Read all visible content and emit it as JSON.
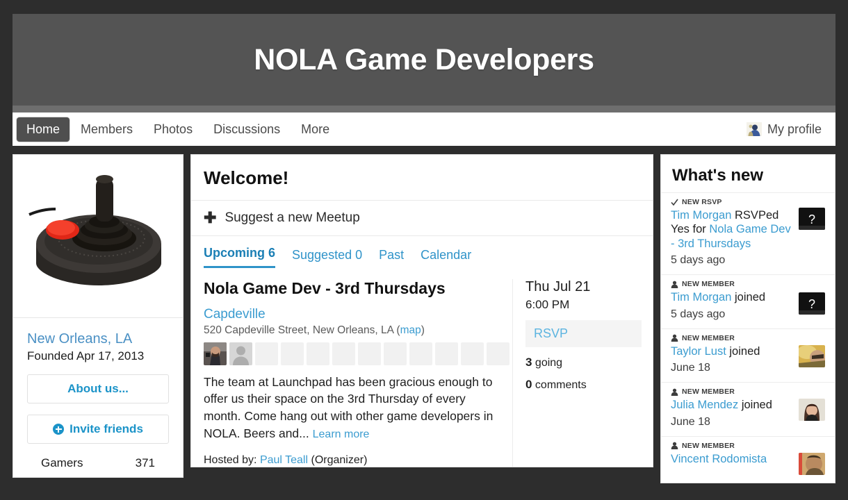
{
  "banner": {
    "title": "NOLA Game Developers"
  },
  "nav": {
    "items": [
      {
        "label": "Home",
        "active": true
      },
      {
        "label": "Members",
        "active": false
      },
      {
        "label": "Photos",
        "active": false
      },
      {
        "label": "Discussions",
        "active": false
      },
      {
        "label": "More",
        "active": false
      }
    ],
    "profile_label": "My profile",
    "profile_icon": "person-avatar-icon"
  },
  "sidebar_left": {
    "group_photo_icon": "atari-joystick-photo",
    "location": "New Orleans, LA",
    "founded": "Founded Apr 17, 2013",
    "about_label": "About us...",
    "invite_label": "Invite friends",
    "invite_icon": "plus-circle-icon",
    "member_label": "Gamers",
    "member_count": "371"
  },
  "main": {
    "welcome_title": "Welcome!",
    "suggest_label": "Suggest a new Meetup",
    "suggest_icon": "plus-icon",
    "tabs": [
      {
        "label": "Upcoming 6",
        "active": true
      },
      {
        "label": "Suggested 0",
        "active": false
      },
      {
        "label": "Past",
        "active": false
      },
      {
        "label": "Calendar",
        "active": false
      }
    ],
    "event": {
      "title": "Nola Game Dev - 3rd Thursdays",
      "venue": "Capdeville",
      "address": "520 Capdeville Street, New Orleans, LA (",
      "map_label": "map",
      "address_close": ")",
      "attendee_slots": 12,
      "attendees_filled": 2,
      "description": "The team at Launchpad has been gracious enough to offer us their space on the 3rd Thursday of every month. Come hang out with other game developers in NOLA. Beers and...",
      "learn_more": "Learn more",
      "hosted_prefix": "Hosted by:",
      "host_name": "Paul Teall",
      "host_role": "(Organizer)",
      "date": "Thu Jul 21",
      "time": "6:00 PM",
      "rsvp_label": "RSVP",
      "going_count": "3",
      "going_label": "going",
      "comments_count": "0",
      "comments_label": "comments"
    }
  },
  "sidebar_right": {
    "title": "What's new",
    "items": [
      {
        "kind": "NEW RSVP",
        "kind_icon": "check-icon",
        "actor": "Tim Morgan",
        "action": "RSVPed Yes for",
        "target": "Nola Game Dev - 3rd Thursdays",
        "time": "5 days ago",
        "avatar": "question-mark-photo"
      },
      {
        "kind": "NEW MEMBER",
        "kind_icon": "person-icon",
        "actor": "Tim Morgan",
        "action": "joined",
        "target": "",
        "time": "5 days ago",
        "avatar": "question-mark-photo"
      },
      {
        "kind": "NEW MEMBER",
        "kind_icon": "person-icon",
        "actor": "Taylor Lust",
        "action": "joined",
        "target": "",
        "time": "June 18",
        "avatar": "sunglasses-portrait-photo"
      },
      {
        "kind": "NEW MEMBER",
        "kind_icon": "person-icon",
        "actor": "Julia Mendez",
        "action": "joined",
        "target": "",
        "time": "June 18",
        "avatar": "woman-portrait-photo"
      },
      {
        "kind": "NEW MEMBER",
        "kind_icon": "person-icon",
        "actor": "Vincent Rodomista",
        "action": "",
        "target": "",
        "time": "",
        "avatar": "man-portrait-photo"
      }
    ]
  },
  "colors": {
    "banner_bg": "#545454",
    "accent_blue": "#3b9cd0",
    "link_blue": "#1b93c8",
    "frame_dark": "#2d2d2d"
  }
}
